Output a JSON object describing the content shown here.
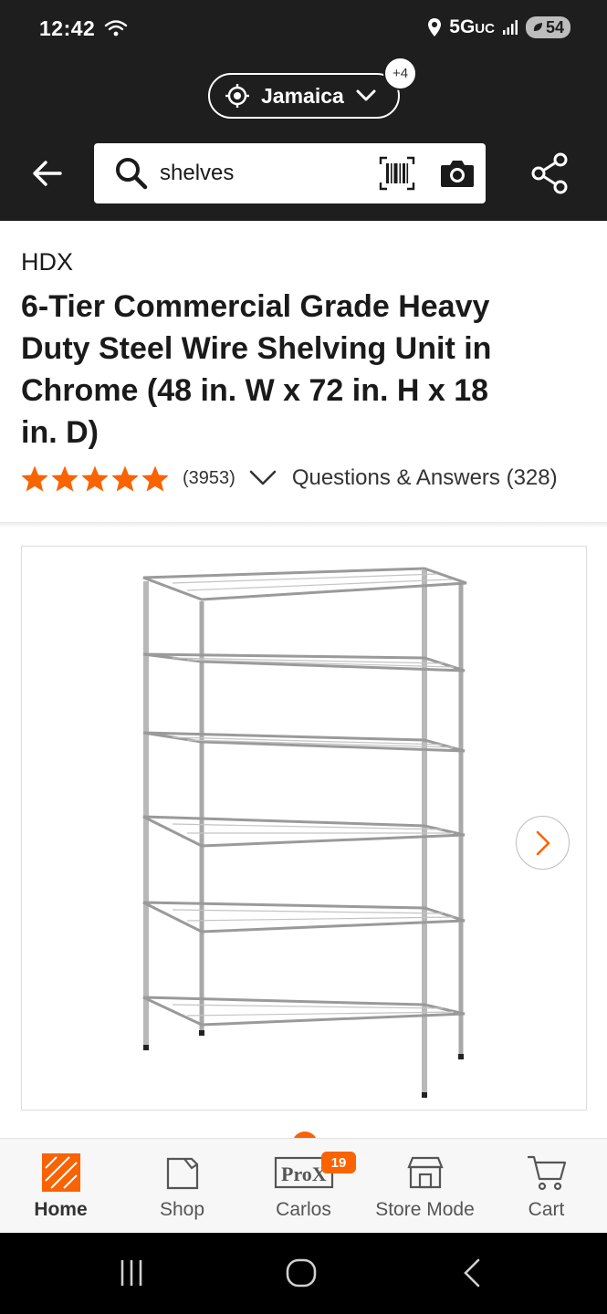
{
  "status_bar": {
    "time": "12:42",
    "network": "5G",
    "network_suffix": "UC",
    "battery": "54"
  },
  "location": {
    "label": "Jamaica",
    "extra_count": "+4"
  },
  "search": {
    "value": "shelves"
  },
  "product": {
    "brand": "HDX",
    "title": "6-Tier Commercial Grade Heavy Duty Steel Wire Shelving Unit in Chrome (48 in. W x 72 in. H x 18 in. D)",
    "rating": 5,
    "review_count": "(3953)",
    "qa_label": "Questions & Answers (328)"
  },
  "gallery": {
    "current_index": 1,
    "total_visible_dots": 2
  },
  "bottom_nav": {
    "items": [
      {
        "label": "Home",
        "icon": "home-depot-logo-icon",
        "active": true
      },
      {
        "label": "Shop",
        "icon": "shop-bag-icon",
        "active": false
      },
      {
        "label": "Carlos",
        "icon": "pro-xtra-icon",
        "active": false
      },
      {
        "label": "Store Mode",
        "icon": "store-icon",
        "active": false
      },
      {
        "label": "Cart",
        "icon": "cart-icon",
        "active": false
      }
    ],
    "pro_badge": "19"
  },
  "colors": {
    "brand_orange": "#f96302",
    "header_bg": "#1e1e1e",
    "star": "#f96302"
  }
}
